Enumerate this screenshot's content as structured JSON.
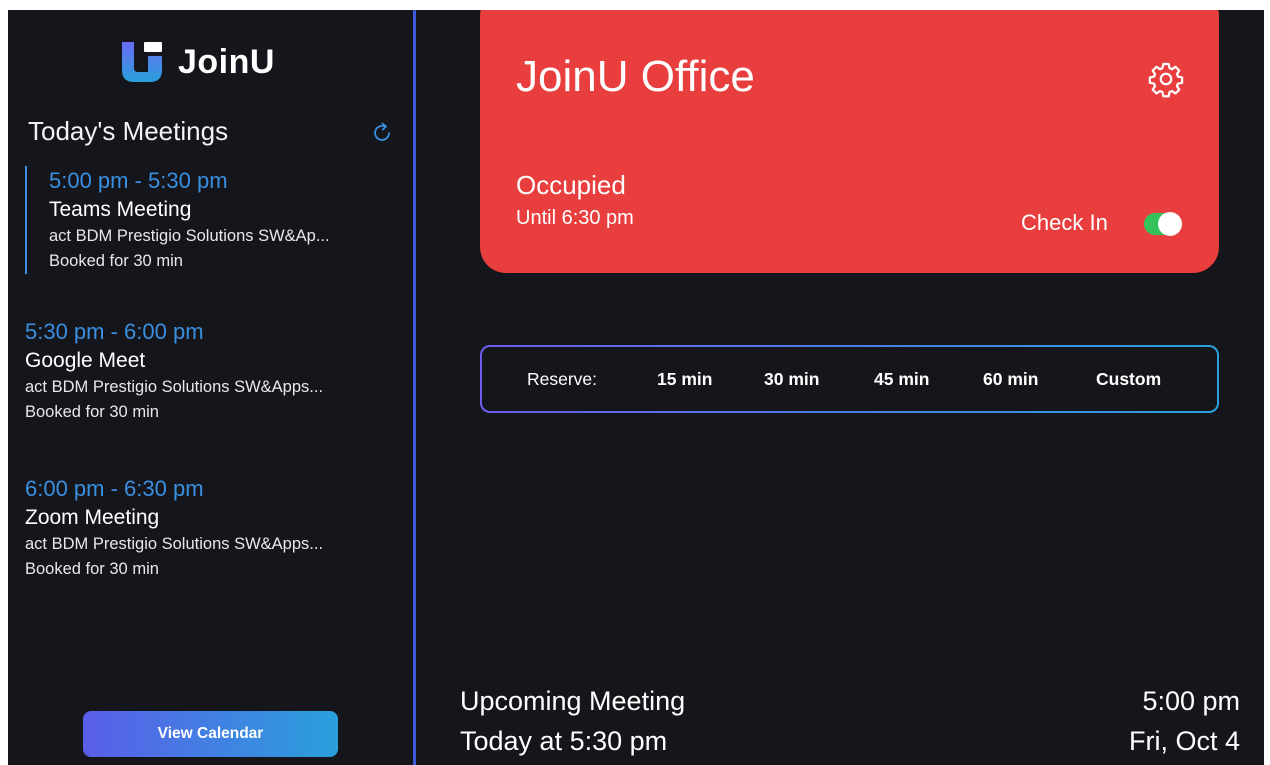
{
  "app": {
    "name": "JoinU"
  },
  "sidebar": {
    "title": "Today's Meetings",
    "meetings": [
      {
        "time": "5:00 pm - 5:30 pm",
        "title": "Teams Meeting",
        "organizer": "act BDM Prestigio Solutions SW&Ap...",
        "duration": "Booked for 30 min"
      },
      {
        "time": "5:30 pm - 6:00 pm",
        "title": "Google Meet",
        "organizer": "act BDM Prestigio Solutions SW&Apps...",
        "duration": "Booked for 30 min"
      },
      {
        "time": "6:00 pm - 6:30 pm",
        "title": "Zoom Meeting",
        "organizer": "act BDM Prestigio Solutions SW&Apps...",
        "duration": "Booked for 30 min"
      }
    ],
    "view_calendar_label": "View Calendar"
  },
  "room": {
    "name": "JoinU Office",
    "status": "Occupied",
    "until": "Until 6:30 pm",
    "checkin_label": "Check In"
  },
  "reserve": {
    "label": "Reserve:",
    "options": [
      "15 min",
      "30 min",
      "45 min",
      "60 min",
      "Custom"
    ]
  },
  "footer": {
    "upcoming_title": "Upcoming Meeting",
    "upcoming_time": "Today at 5:30 pm",
    "current_time": "5:00 pm",
    "current_date": "Fri, Oct 4"
  },
  "colors": {
    "background": "#15161b",
    "accent_blue": "#3a8fe0",
    "status_red": "#e83e3e",
    "toggle_green": "#35c25a"
  },
  "icons": [
    "joinu-logo-icon",
    "refresh-icon",
    "gear-icon"
  ]
}
